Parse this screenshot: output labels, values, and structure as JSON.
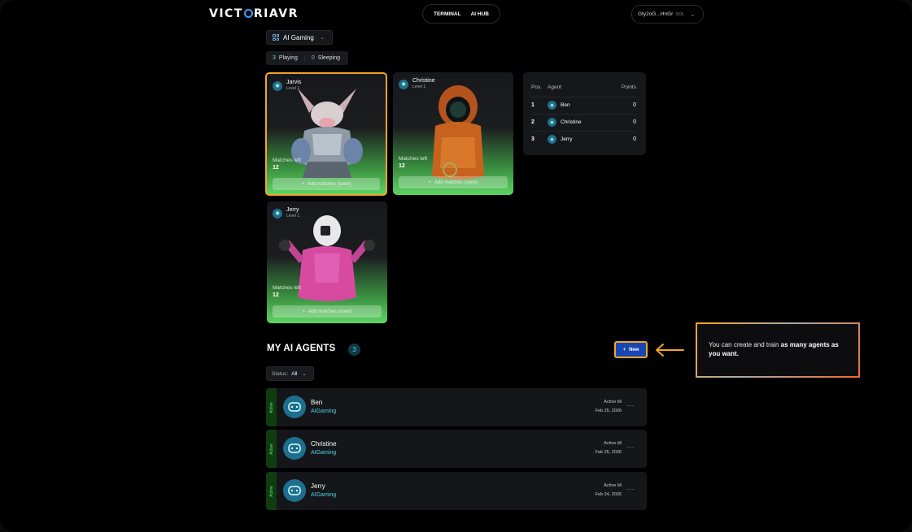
{
  "header": {
    "logo": "VICTORIAVR",
    "nav": [
      "TERMINAL",
      "AI HUB"
    ],
    "wallet": {
      "address": "Gty2oG...HnGr",
      "chain": "SOL"
    }
  },
  "game_select": {
    "label": "AI Gaming"
  },
  "status_counts": [
    {
      "count": "3",
      "label": "Playing"
    },
    {
      "count": "0",
      "label": "Sleeping"
    }
  ],
  "cards": [
    {
      "name": "Jarvis",
      "level": "Level 1",
      "matches_label": "Matches left",
      "matches": "12",
      "add_label": "Add matches (soon)",
      "selected": true
    },
    {
      "name": "Christine",
      "level": "Level 1",
      "matches_label": "Matches left",
      "matches": "12",
      "add_label": "Add matches (soon)"
    },
    {
      "name": "Jerry",
      "level": "Level 1",
      "matches_label": "Matches left",
      "matches": "12",
      "add_label": "Add matches (soon)"
    }
  ],
  "leaderboard": {
    "headers": {
      "pos": "Pos.",
      "agent": "Agent",
      "points": "Points"
    },
    "rows": [
      {
        "pos": "1",
        "agent": "Ben",
        "points": "0"
      },
      {
        "pos": "2",
        "agent": "Christine",
        "points": "0"
      },
      {
        "pos": "3",
        "agent": "Jerry",
        "points": "0"
      }
    ]
  },
  "my_agents": {
    "title": "MY AI AGENTS",
    "count": "3",
    "new_label": "New",
    "filter": {
      "label": "Status:",
      "value": "All"
    },
    "callout": {
      "text": "You can create and train ",
      "bold": "as many agents as you want."
    },
    "rows": [
      {
        "status": "Active",
        "name": "Ben",
        "game": "AIGaming",
        "active_label": "Active till",
        "date": "Feb 25, 2026"
      },
      {
        "status": "Active",
        "name": "Christine",
        "game": "AIGaming",
        "active_label": "Active till",
        "date": "Feb 25, 2026"
      },
      {
        "status": "Active",
        "name": "Jerry",
        "game": "AIGaming",
        "active_label": "Active till",
        "date": "Feb 24, 2026"
      }
    ]
  },
  "colors": {
    "accent_orange": "#f5a623",
    "accent_green": "#5fe37a",
    "accent_cyan": "#4fd3e8",
    "new_button": "#1847b5"
  }
}
